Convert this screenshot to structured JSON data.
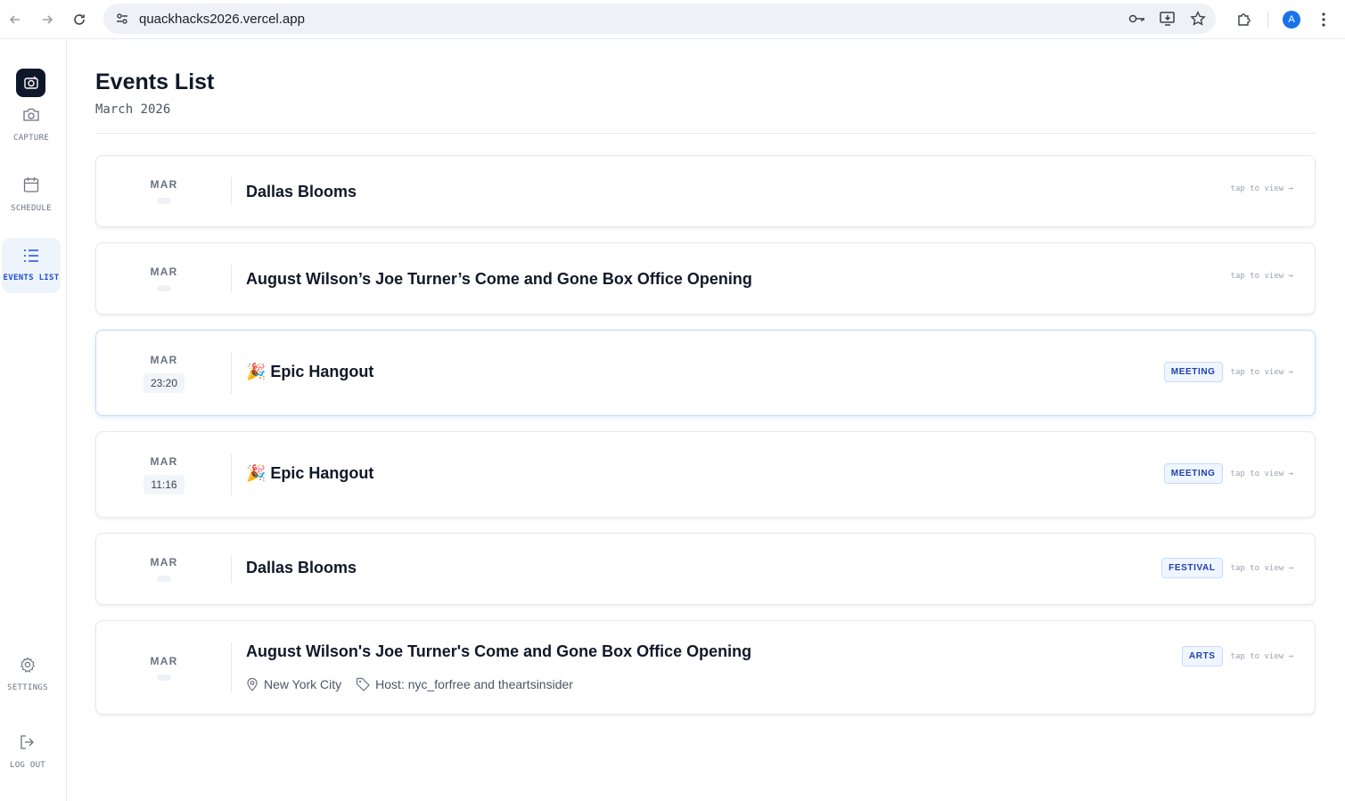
{
  "browser": {
    "url": "quackhacks2026.vercel.app",
    "avatar_letter": "A"
  },
  "sidebar": {
    "items": [
      {
        "label": "CAPTURE",
        "icon": "camera-icon"
      },
      {
        "label": "SCHEDULE",
        "icon": "calendar-icon"
      },
      {
        "label": "EVENTS LIST",
        "icon": "list-icon",
        "active": true
      },
      {
        "label": "SETTINGS",
        "icon": "gear-icon"
      },
      {
        "label": "LOG OUT",
        "icon": "logout-icon"
      }
    ]
  },
  "page": {
    "title": "Events List",
    "subtitle": "March 2026"
  },
  "events": [
    {
      "month": "MAR",
      "time": "",
      "title": "Dallas Blooms",
      "tag": "",
      "tap": "tap to view →"
    },
    {
      "month": "MAR",
      "time": "",
      "title": "August Wilson’s Joe Turner’s Come and Gone Box Office Opening",
      "tag": "",
      "tap": "tap to view →"
    },
    {
      "month": "MAR",
      "time": "23:20",
      "title": "🎉 Epic Hangout",
      "tag": "MEETING",
      "tap": "tap to view →"
    },
    {
      "month": "MAR",
      "time": "11:16",
      "title": "🎉 Epic Hangout",
      "tag": "MEETING",
      "tap": "tap to view →"
    },
    {
      "month": "MAR",
      "time": "",
      "title": "Dallas Blooms",
      "tag": "FESTIVAL",
      "tap": "tap to view →"
    },
    {
      "month": "MAR",
      "time": "",
      "title": "August Wilson's Joe Turner's Come and Gone Box Office Opening",
      "tag": "ARTS",
      "tap": "tap to view →",
      "location": "New York City",
      "host": "Host: nyc_forfree and theartsinsider"
    }
  ],
  "colors": {
    "accent": "#1d4ed8",
    "tag_bg": "#eff6ff",
    "sidebar_active_bg": "#eef4fb"
  }
}
